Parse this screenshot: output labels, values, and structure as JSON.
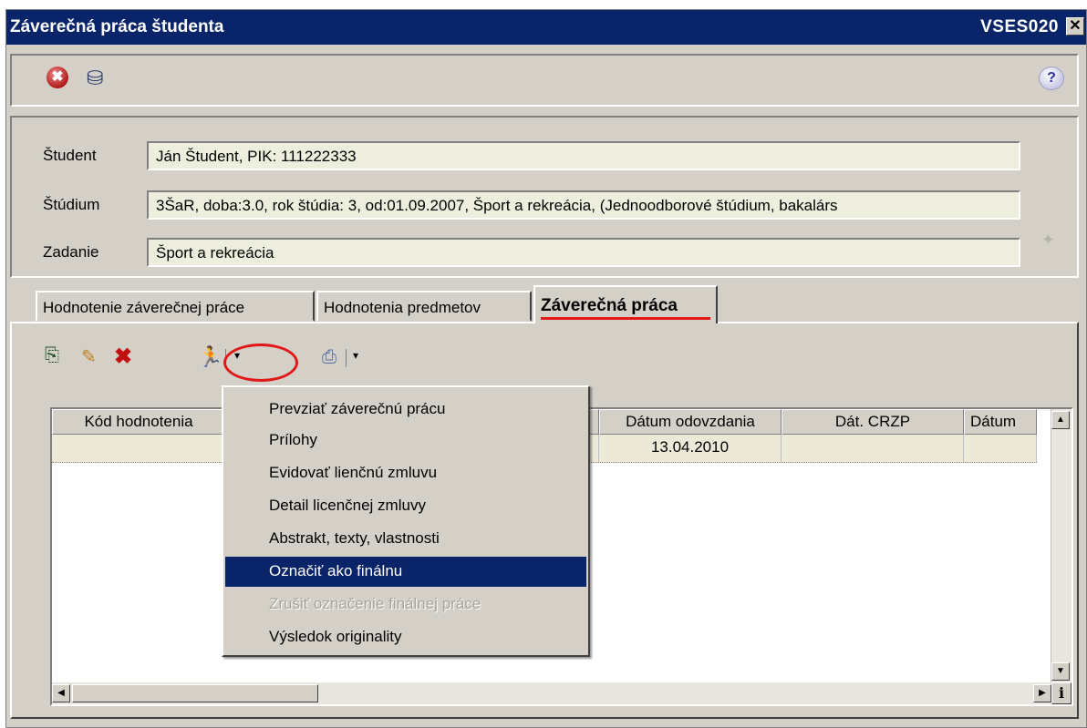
{
  "window": {
    "title": "Záverečná práca študenta",
    "code": "VSES020",
    "close": "✕"
  },
  "toolbar": {
    "exit_glyph": "✖",
    "db_glyph": "⛁",
    "help_glyph": "?"
  },
  "form": {
    "student_label": "Študent",
    "student_value": "Ján Študent, PIK: 111222333",
    "study_label": "Štúdium",
    "study_value": "3ŠaR, doba:3.0, rok štúdia: 3, od:01.09.2007, Šport a rekreácia, (Jednoodborové štúdium, bakalárs",
    "assignment_label": "Zadanie",
    "assignment_value": "Šport a rekreácia"
  },
  "tabs": [
    {
      "label": "Hodnotenie záverečnej práce"
    },
    {
      "label": "Hodnotenia predmetov"
    },
    {
      "label": "Záverečná práca"
    }
  ],
  "actions": {
    "new_glyph": "⎘",
    "edit_glyph": "✎",
    "delete_glyph": "✖",
    "run_glyph": "🏃",
    "print_glyph": "⎙",
    "dropdown_glyph": "▾"
  },
  "table": {
    "columns": [
      "Kód hodnotenia",
      "Dátum odovzdania",
      "Dát. CRZP",
      "Dátum"
    ],
    "rows": [
      {
        "date_submitted": "13.04.2010",
        "crzp": "",
        "date": ""
      }
    ]
  },
  "menu": {
    "items": [
      "Prevziať záverečnú prácu",
      "Prílohy",
      "Evidovať lienčnú zmluvu",
      "Detail licenčnej zmluvy",
      "Abstrakt, texty, vlastnosti",
      "Označiť ako finálnu",
      "Zrušiť označenie finálnej práce",
      "Výsledok originality"
    ],
    "selected_index": 5,
    "disabled_index": 6
  },
  "colors": {
    "title_bar": "#0a246a",
    "highlight": "#0a246a",
    "annotation_red": "#e01818",
    "face": "#d4d0c8",
    "field_bg": "#eeeede"
  }
}
